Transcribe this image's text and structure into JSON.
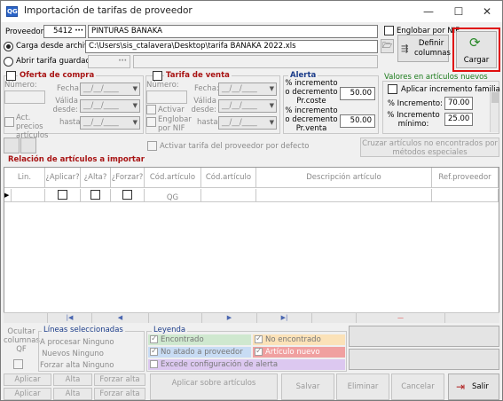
{
  "window": {
    "title": "Importación de tarifas de proveedor",
    "minimize": "—",
    "maximize": "☐",
    "close": "✕"
  },
  "provider": {
    "label": "Proveedor:",
    "code": "5412",
    "name": "PINTURAS BANAKA",
    "englobar_label": "Englobar por NIF"
  },
  "source": {
    "load_file_label": "Carga desde archivo",
    "file_path": "C:\\Users\\sis_ctalavera\\Desktop\\tarifa BANAKA 2022.xls",
    "saved_rate_label": "Abrir tarifa guardada",
    "definir_columnas_label": "Definir columnas",
    "cargar_label": "Cargar"
  },
  "oferta": {
    "title": "Oferta de compra",
    "numero_label": "Número:",
    "fecha_label": "Fecha:",
    "valida_desde_label": "Válida desde:",
    "hasta_label": "hasta:",
    "act_precios_label": "Act. precios artículos",
    "date_placeholder": "__/__/____"
  },
  "tarifa": {
    "title": "Tarifa de venta",
    "numero_label": "Número:",
    "fecha_label": "Fecha:",
    "activar_label": "Activar",
    "englobar_label": "Englobar por NIF",
    "valida_desde_label": "Válida desde:",
    "hasta_label": "hasta:"
  },
  "alerta": {
    "title": "Alerta",
    "coste_label": "% incremento o decremento Pr.coste",
    "coste_value": "50.00",
    "venta_label": "% incremento o decremento Pr.venta",
    "venta_value": "50.00"
  },
  "valores": {
    "title": "Valores en artículos nuevos",
    "aplicar_incremento_label": "Aplicar incremento familia",
    "incremento_label": "% Incremento:",
    "incremento_value": "70.00",
    "incremento_minimo_label": "% Incremento mínimo:",
    "incremento_minimo_value": "25.00"
  },
  "toolbar": {
    "activar_tarifa_label": "Activar tarifa del proveedor por defecto",
    "cruzar_label": "Cruzar artículos no encontrados por métodos especiales"
  },
  "grid": {
    "title": "Relación de artículos a importar",
    "columns": [
      "Lin.",
      "¿Aplicar?",
      "¿Alta?",
      "¿Forzar?",
      "Cód.artículo QG",
      "Cód.artículo",
      "Descripción artículo",
      "Ref.proveedor"
    ],
    "row_indicator": "▶"
  },
  "footer": {
    "ocultar_label": "Ocultar columnas QF",
    "lineas_title": "Líneas seleccionadas",
    "a_procesar_label": "A procesar Ninguno",
    "nuevos_label": "Nuevos Ninguno",
    "forzar_alta_label": "Forzar alta Ninguno",
    "leyenda_title": "Leyenda",
    "legend": {
      "encontrado": "Encontrado",
      "no_encontrado": "No encontrado",
      "no_atado": "No atado a proveedor",
      "articulo_nuevo": "Artículo nuevo",
      "excede": "Excede configuración de alerta"
    },
    "aplicar_label": "Aplicar",
    "alta_label": "Alta",
    "forzar_alta_btn": "Forzar alta",
    "aplicar_sobre_label": "Aplicar sobre artículos",
    "salvar_label": "Salvar",
    "eliminar_label": "Eliminar",
    "cancelar_label": "Cancelar",
    "salir_label": "Salir"
  },
  "colors": {
    "encontrado": "#cfe8cf",
    "no_encontrado": "#fbe2b8",
    "no_atado": "#c8dcf4",
    "articulo_nuevo": "#f0a0a0",
    "excede": "#dcc8f0",
    "highlight": "#e01010"
  }
}
